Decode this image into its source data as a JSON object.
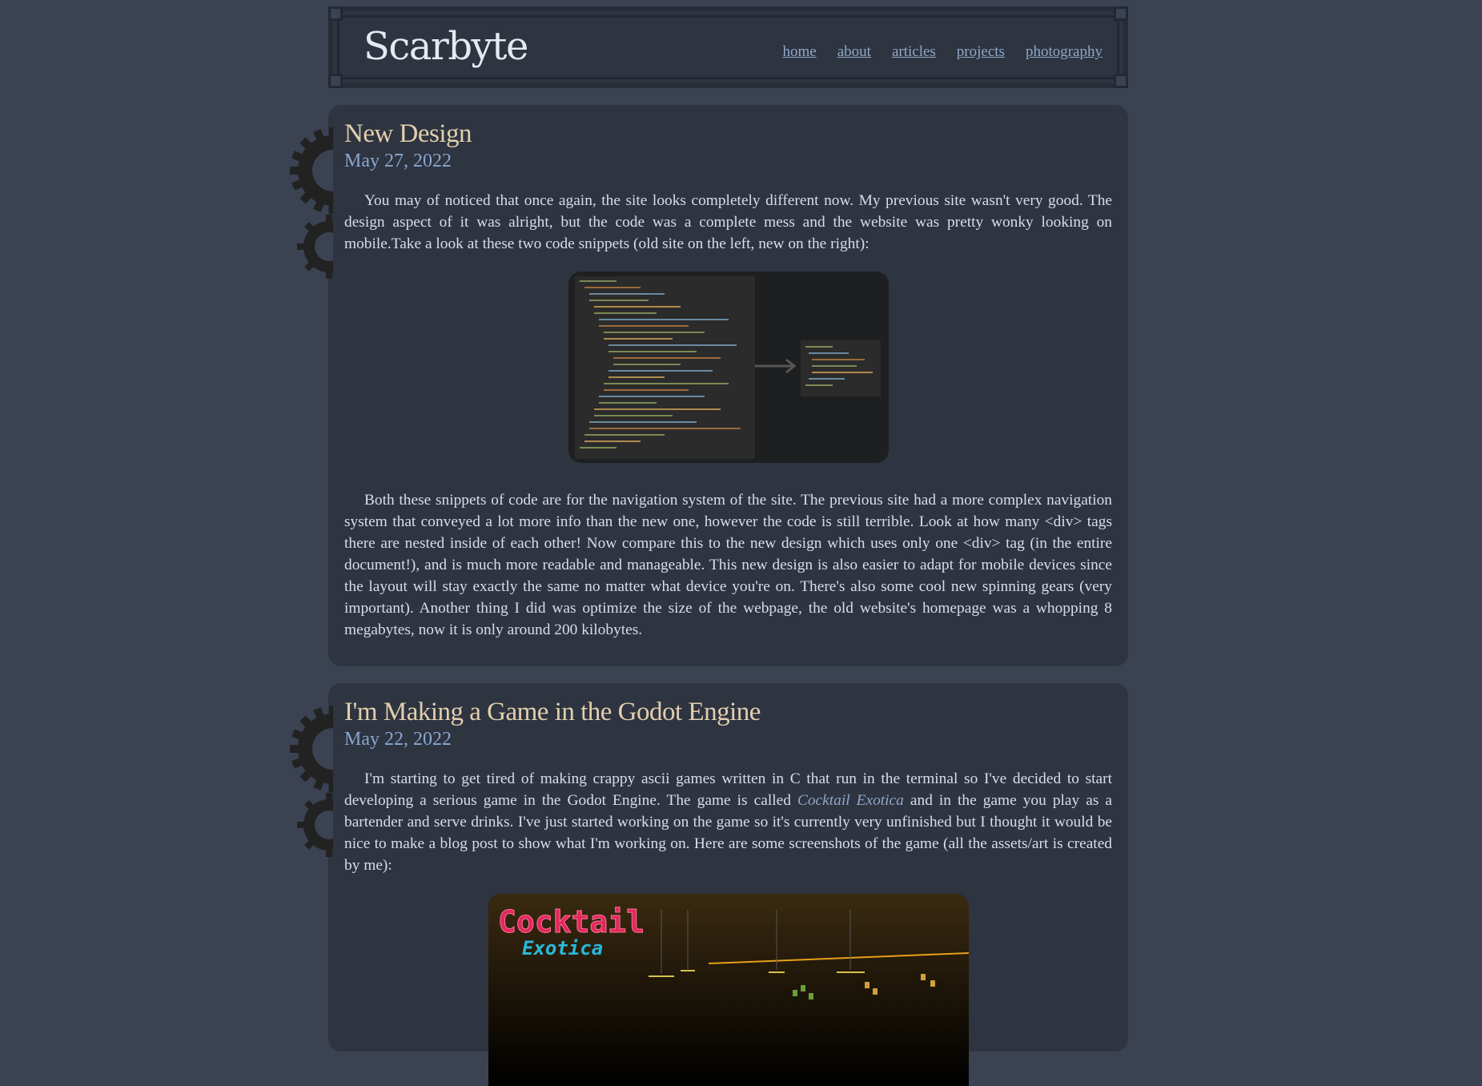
{
  "site": {
    "title": "Scarbyte",
    "nav": [
      "home",
      "about",
      "articles",
      "projects",
      "photography"
    ]
  },
  "posts": [
    {
      "title": "New Design",
      "date": "May 27, 2022",
      "p1": "You may of noticed that once again, the site looks completely different now. My previous site wasn't very good. The design aspect of it was alright, but the code was a complete mess and the website was pretty wonky looking on mobile.Take a look at these two code snippets (old site on the left, new on the right):",
      "p2": "Both these snippets of code are for the navigation system of the site. The previous site had a more complex navigation system that conveyed a lot more info than the new one, however the code is still terrible. Look at how many <div> tags there are nested inside of each other! Now compare this to the new design which uses only one <div> tag (in the entire document!), and is much more readable and manageable. This new design is also easier to adapt for mobile devices since the layout will stay exactly the same no matter what device you're on. There's also some cool new spinning gears (very important). Another thing I did was optimize the size of the webpage, the old website's homepage was a whopping 8 megabytes, now it is only around 200 kilobytes."
    },
    {
      "title": "I'm Making a Game in the Godot Engine",
      "date": "May 22, 2022",
      "p1_before": "I'm starting to get tired of making crappy ascii games written in C that run in the terminal so I've decided to start developing a serious game in the Godot Engine. The game is called ",
      "p1_link": "Cocktail Exotica",
      "p1_after": " and in the game you play as a bartender and serve drinks. I've just started working on the game so it's currently very unfinished but I thought it would be nice to make a blog post to show what I'm working on. Here are some screenshots of the game (all the assets/art is created by me):",
      "game_logo_line1": "Cocktail",
      "game_logo_line2": "Exotica"
    }
  ]
}
